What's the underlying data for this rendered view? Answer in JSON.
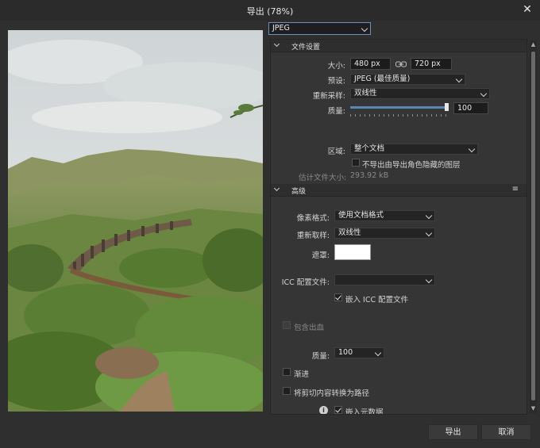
{
  "window": {
    "title": "导出 (78%)",
    "close_glyph": "✕"
  },
  "format": {
    "selected": "JPEG"
  },
  "file_settings": {
    "section_title": "文件设置",
    "size_label": "大小:",
    "width_value": "480 px",
    "height_value": "720 px",
    "preset_label": "预设:",
    "preset_value": "JPEG (最佳质量)",
    "resample_label": "重新采样:",
    "resample_value": "双线性",
    "quality_label": "质量:",
    "quality_value": "100",
    "quality_fraction": 1.0,
    "area_label": "区域:",
    "area_value": "整个文档",
    "hidden_layers_label": "不导出由导出角色隐藏的图层",
    "hidden_layers_checked": false,
    "estimate_label": "估计文件大小:",
    "estimate_value": "293.92 kB"
  },
  "advanced": {
    "section_title": "高级",
    "menu_glyph": "≡",
    "pixel_format_label": "像素格式:",
    "pixel_format_value": "使用文档格式",
    "resample_label": "重新取样:",
    "resample_value": "双线性",
    "matte_label": "遮罩:",
    "matte_color": "#ffffff",
    "icc_label": "ICC 配置文件:",
    "icc_value": "",
    "embed_icc_label": "嵌入 ICC 配置文件",
    "embed_icc_checked": true,
    "bleed_label": "包含出血",
    "bleed_checked": false,
    "quality_label": "质量:",
    "quality_value": "100",
    "progressive_label": "渐进",
    "progressive_checked": false,
    "convert_paths_label": "将剪切内容转换为路径",
    "convert_paths_checked": false,
    "embed_metadata_label": "嵌入元数据",
    "embed_metadata_checked": true,
    "info_glyph": "i"
  },
  "buttons": {
    "export_label": "导出",
    "cancel_label": "取消"
  },
  "colors": {
    "accent": "#5b84b8",
    "panel_bg": "#353535",
    "window_bg": "#2f2f2f"
  },
  "icons": [
    "close-icon",
    "chevron-down-icon",
    "link-icon",
    "menu-icon",
    "info-icon",
    "checkmark-icon"
  ]
}
